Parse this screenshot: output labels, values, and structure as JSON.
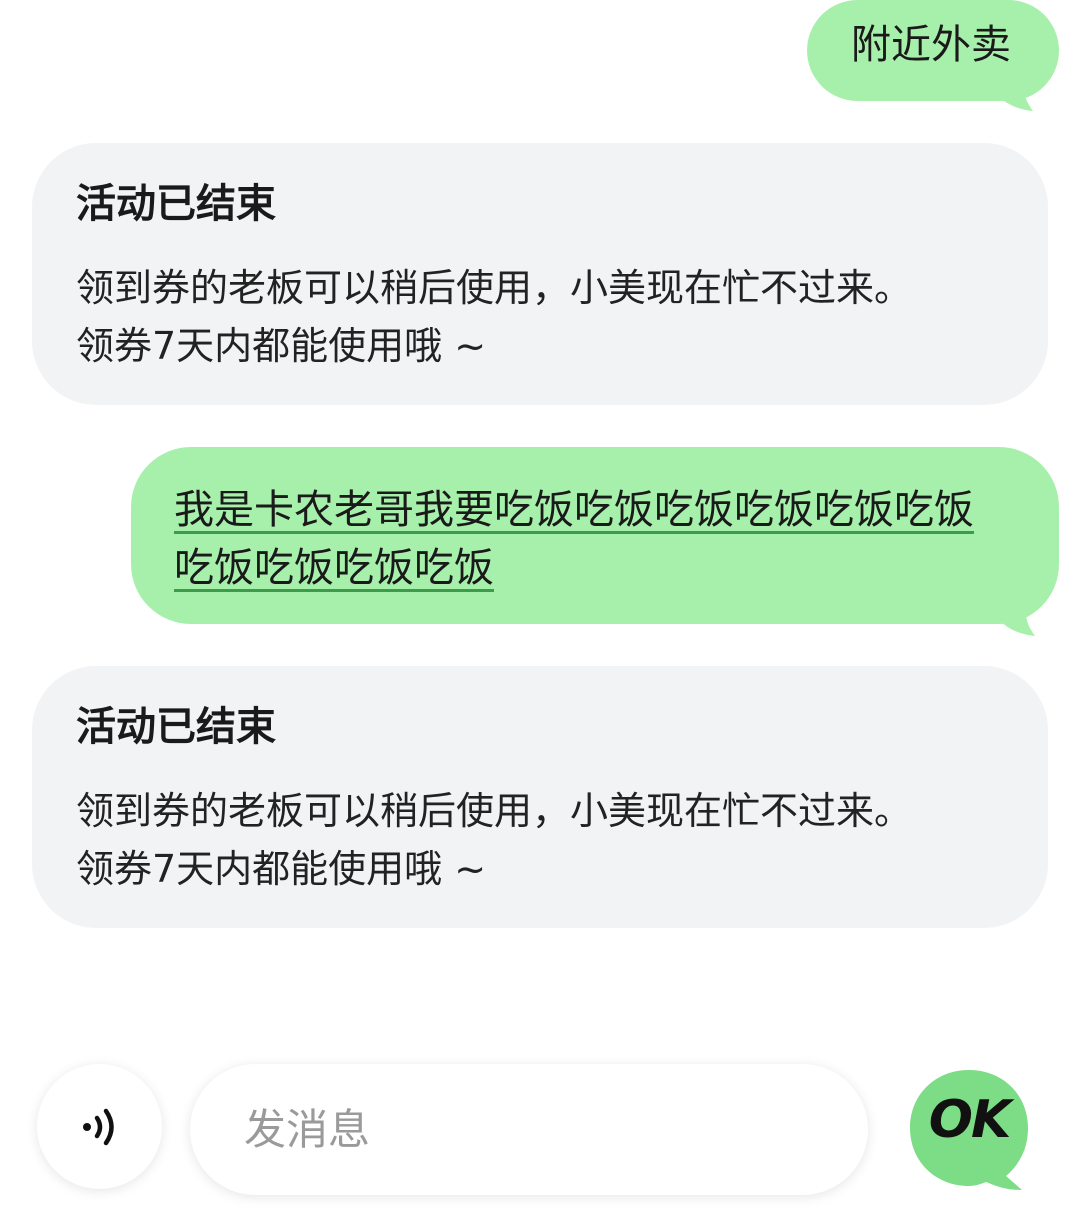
{
  "messages": [
    {
      "direction": "outgoing",
      "text": "附近外卖"
    },
    {
      "direction": "incoming",
      "title": "活动已结束",
      "lines": [
        "领到券的老板可以稍后使用，小美现在忙不过来。",
        "领券7天内都能使用哦 ~"
      ]
    },
    {
      "direction": "outgoing",
      "lines": [
        "我是卡农老哥我要吃饭吃饭吃饭吃饭吃饭吃饭",
        "吃饭吃饭吃饭吃饭"
      ]
    },
    {
      "direction": "incoming",
      "title": "活动已结束",
      "lines": [
        "领到券的老板可以稍后使用，小美现在忙不过来。",
        "领券7天内都能使用哦 ~"
      ]
    }
  ],
  "input": {
    "placeholder": "发消息",
    "value": ""
  },
  "buttons": {
    "voice_icon": "voice-wave-icon",
    "send_label": "OK"
  },
  "colors": {
    "outgoing_bubble": "#a7f0ab",
    "incoming_bubble": "#f2f3f5",
    "ok_button": "#7ddc86",
    "link_underline": "#3d9c4a"
  }
}
